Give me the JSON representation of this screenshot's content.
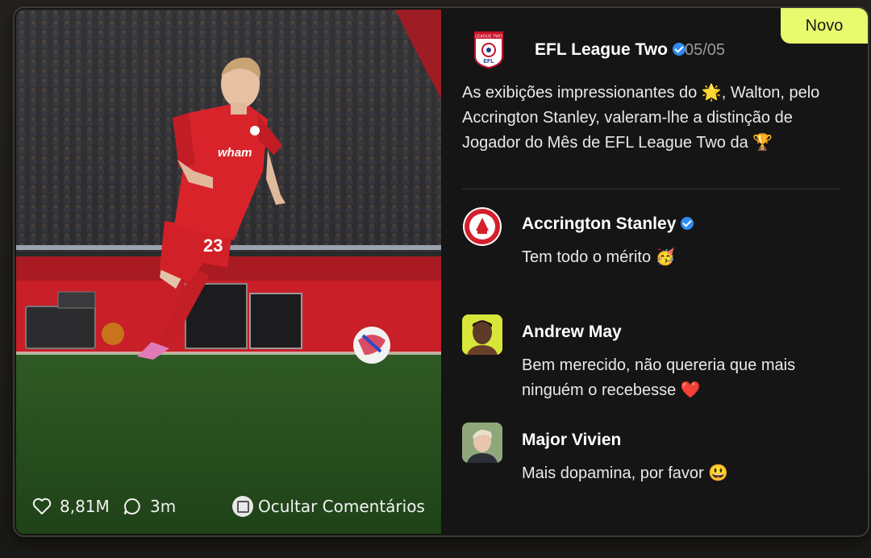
{
  "badge": "Novo",
  "media": {
    "likes": "8,81M",
    "comments": "3m",
    "hide_comments": "Ocultar Comentários",
    "player_number": "23",
    "sponsor": "wham"
  },
  "post": {
    "author": "EFL League Two",
    "date": "05/05",
    "logo_top": "LEAGUE TWO",
    "logo_bottom": "EFL",
    "text": "As exibições impressionantes do 🌟, Walton, pelo Accrington Stanley, valeram-lhe a distinção de Jogador do Mês de EFL League Two da 🏆"
  },
  "comments": [
    {
      "author": "Accrington Stanley",
      "verified": true,
      "text": "Tem todo o mérito 🥳"
    },
    {
      "author": "Andrew May",
      "verified": false,
      "text": "Bem merecido, não quereria que mais ninguém o recebesse ❤️"
    },
    {
      "author": "Major Vivien",
      "verified": false,
      "text": "Mais dopamina, por favor 😃"
    }
  ],
  "colors": {
    "accent": "#e8fa6d",
    "verified": "#2f8cf2",
    "kit_red": "#d8232a"
  }
}
